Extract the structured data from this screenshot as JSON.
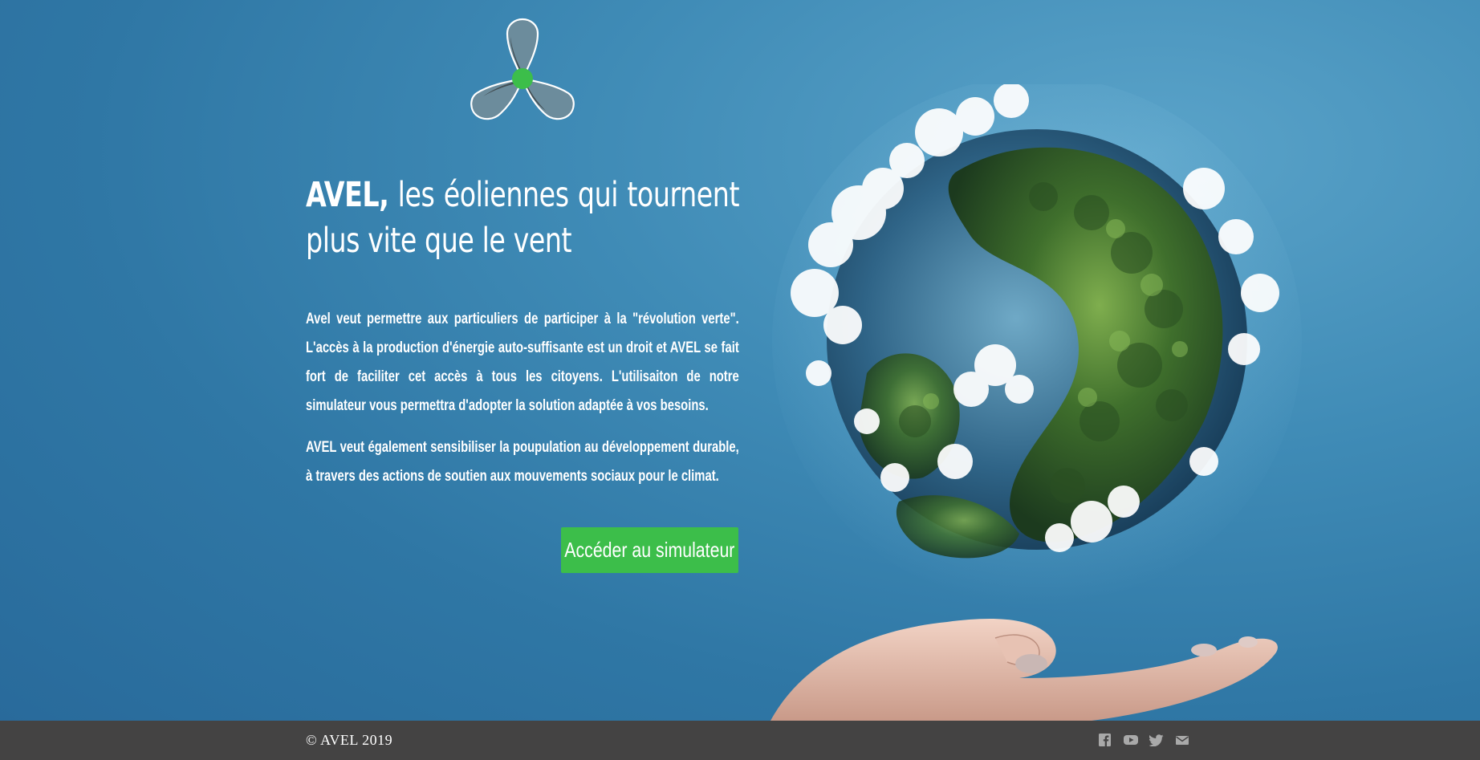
{
  "hero": {
    "title_brand": "AVEL,",
    "title_rest": " les éoliennes qui tournent plus vite que le vent",
    "paragraph_1": "Avel veut permettre aux particuliers de participer à la \"révolution verte\". L'accès à la production d'énergie auto-suffisante est un droit et AVEL se fait fort de faciliter cet accès à tous les citoyens. L'utilisaiton de notre simulateur vous permettra d'adopter la solution adaptée à vos besoins.",
    "paragraph_2": "AVEL veut également sensibiliser la poupulation au développement durable, à travers des actions de soutien aux mouvements sociaux pour le climat.",
    "cta_label": "Accéder au simulateur"
  },
  "footer": {
    "copyright": "© AVEL 2019",
    "social_icons": [
      "facebook-icon",
      "youtube-icon",
      "twitter-icon",
      "mail-icon"
    ]
  },
  "colors": {
    "background": "#2f77a5",
    "accent": "#3cbe4a",
    "footer": "#444343",
    "text": "#ffffff",
    "icon": "#a9a9a9"
  }
}
